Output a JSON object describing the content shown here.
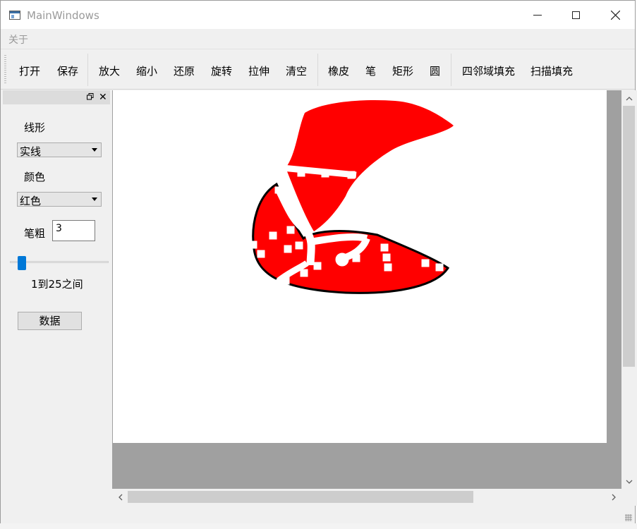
{
  "window": {
    "title": "MainWindows"
  },
  "menu": {
    "items": [
      "关于"
    ]
  },
  "toolbar": {
    "file": [
      "打开",
      "保存"
    ],
    "view": [
      "放大",
      "缩小",
      "还原",
      "旋转",
      "拉伸",
      "清空"
    ],
    "draw": [
      "橡皮",
      "笔",
      "矩形",
      "圆"
    ],
    "fill": [
      "四邻域填充",
      "扫描填充"
    ]
  },
  "dock": {
    "line_label": "线形",
    "line_value": "实线",
    "color_label": "颜色",
    "color_value": "红色",
    "width_label": "笔粗",
    "width_value": "3",
    "range_text": "1到25之间",
    "data_button": "数据",
    "slider": {
      "min": 1,
      "max": 25,
      "value": 3
    }
  },
  "colors": {
    "fill": "#ff0000",
    "outline": "#000000",
    "slider": "#0078d7"
  }
}
